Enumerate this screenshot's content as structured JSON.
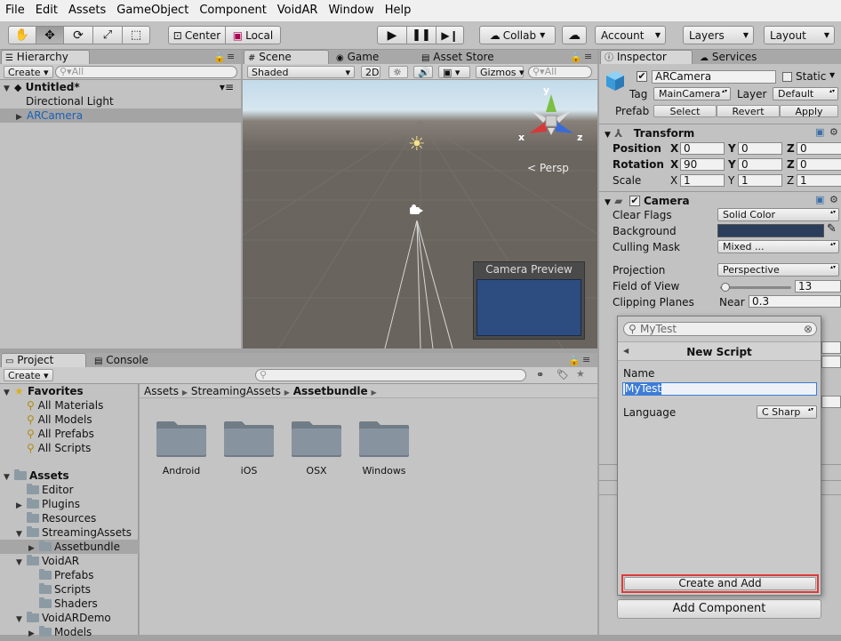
{
  "menu": [
    "File",
    "Edit",
    "Assets",
    "GameObject",
    "Component",
    "VoidAR",
    "Window",
    "Help"
  ],
  "toolbar": {
    "pivot_label": "Center",
    "space_label": "Local",
    "collab_label": "Collab",
    "account_label": "Account",
    "layers_label": "Layers",
    "layout_label": "Layout"
  },
  "hierarchy": {
    "tab": "Hierarchy",
    "create_label": "Create",
    "search_placeholder": "All",
    "scene_name": "Untitled*",
    "items": [
      "Directional Light",
      "ARCamera"
    ]
  },
  "scene": {
    "tabs": [
      "Scene",
      "Game",
      "Asset Store"
    ],
    "shading_mode": "Shaded",
    "mode_2d_label": "2D",
    "gizmos_label": "Gizmos",
    "search_placeholder": "All",
    "persp_label": "Persp",
    "axis_y": "y",
    "axis_x": "x",
    "axis_z": "z",
    "camera_preview_title": "Camera Preview"
  },
  "project": {
    "tabs": [
      "Project",
      "Console"
    ],
    "create_label": "Create",
    "favorites_label": "Favorites",
    "favorites": [
      "All Materials",
      "All Models",
      "All Prefabs",
      "All Scripts"
    ],
    "assets_label": "Assets",
    "tree": [
      {
        "label": "Editor",
        "indent": 1,
        "arrow": ""
      },
      {
        "label": "Plugins",
        "indent": 1,
        "arrow": "▶"
      },
      {
        "label": "Resources",
        "indent": 1,
        "arrow": ""
      },
      {
        "label": "StreamingAssets",
        "indent": 1,
        "arrow": "▼"
      },
      {
        "label": "Assetbundle",
        "indent": 2,
        "arrow": "▶",
        "selected": true
      },
      {
        "label": "VoidAR",
        "indent": 1,
        "arrow": "▼"
      },
      {
        "label": "Prefabs",
        "indent": 2,
        "arrow": ""
      },
      {
        "label": "Scripts",
        "indent": 2,
        "arrow": ""
      },
      {
        "label": "Shaders",
        "indent": 2,
        "arrow": ""
      },
      {
        "label": "VoidARDemo",
        "indent": 1,
        "arrow": "▼"
      },
      {
        "label": "Models",
        "indent": 2,
        "arrow": "▶"
      }
    ],
    "breadcrumb": [
      "Assets",
      "StreamingAssets",
      "Assetbundle"
    ],
    "folders": [
      "Android",
      "iOS",
      "OSX",
      "Windows"
    ]
  },
  "inspector": {
    "tabs": [
      "Inspector",
      "Services"
    ],
    "object_name": "ARCamera",
    "static_label": "Static",
    "tag_label": "Tag",
    "tag_value": "MainCamera",
    "layer_label": "Layer",
    "layer_value": "Default",
    "prefab_label": "Prefab",
    "prefab_select": "Select",
    "prefab_revert": "Revert",
    "prefab_apply": "Apply",
    "transform": {
      "title": "Transform",
      "position_label": "Position",
      "rotation_label": "Rotation",
      "scale_label": "Scale",
      "x": "X",
      "y": "Y",
      "z": "Z",
      "position": [
        "0",
        "0",
        "0"
      ],
      "rotation": [
        "90",
        "0",
        "0"
      ],
      "scale": [
        "1",
        "1",
        "1"
      ]
    },
    "camera": {
      "title": "Camera",
      "clear_flags_label": "Clear Flags",
      "clear_flags_value": "Solid Color",
      "background_label": "Background",
      "background_color": "#2a3e5c",
      "culling_mask_label": "Culling Mask",
      "culling_mask_value": "Mixed ...",
      "projection_label": "Projection",
      "projection_value": "Perspective",
      "fov_label": "Field of View",
      "fov_value": "13",
      "fov_fraction": 0.07,
      "clipping_label": "Clipping Planes",
      "near_label": "Near",
      "near_value": "0.3"
    },
    "add_component_label": "Add Component"
  },
  "popup": {
    "search_value": "MyTest",
    "title": "New Script",
    "name_label": "Name",
    "name_value": "MyTest",
    "language_label": "Language",
    "language_value": "C Sharp",
    "create_button": "Create and Add"
  },
  "colors": {
    "sky_top": "#c8dcea",
    "ground": "#6b655f",
    "accent_red": "#e03a3a",
    "selection_blue": "#3d7cd6"
  }
}
